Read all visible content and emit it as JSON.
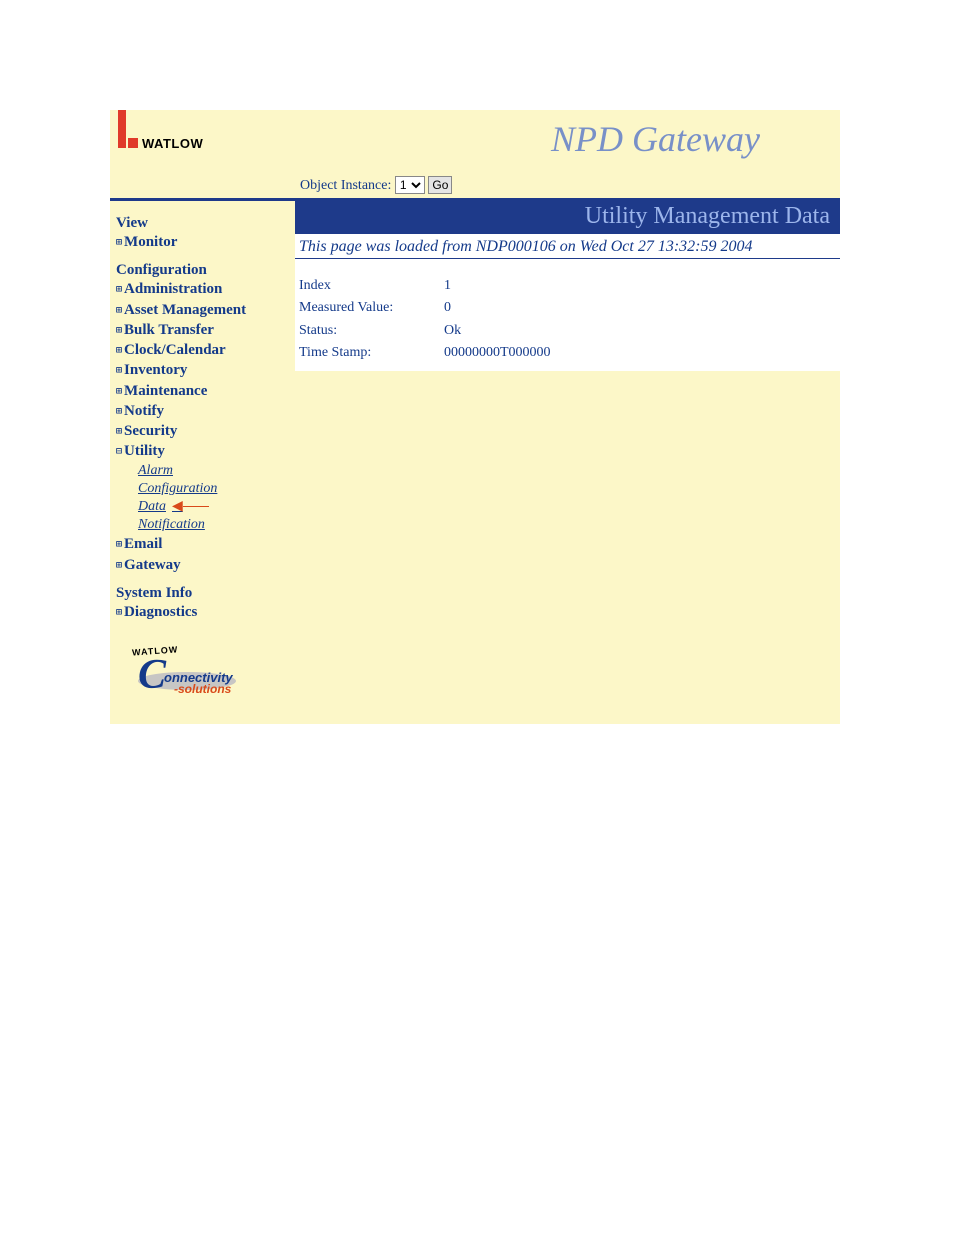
{
  "logo_text": "WATLOW",
  "app_title": "NPD Gateway",
  "object_instance_label": "Object Instance:",
  "object_instance_value": "1",
  "go_label": "Go",
  "sidebar": {
    "view": {
      "heading": "View",
      "monitor": "Monitor"
    },
    "configuration": {
      "heading": "Configuration",
      "administration": "Administration",
      "asset_management": "Asset Management",
      "bulk_transfer": "Bulk Transfer",
      "clock_calendar": "Clock/Calendar",
      "inventory": "Inventory",
      "maintenance": "Maintenance",
      "notify": "Notify",
      "security": "Security",
      "utility": "Utility",
      "utility_children": {
        "alarm": "Alarm",
        "configuration": "Configuration",
        "data": "Data",
        "notification": "Notification"
      },
      "email": "Email",
      "gateway": "Gateway"
    },
    "system_info": {
      "heading": "System Info",
      "diagnostics": "Diagnostics"
    }
  },
  "footer_logo": {
    "arc": "WATLOW",
    "word1": "onnectivity",
    "word2": "-solutions"
  },
  "main": {
    "banner": "Utility Management Data",
    "loaded_msg": "This page was loaded from NDP000106 on Wed Oct 27 13:32:59 2004",
    "rows": {
      "index_label": "Index",
      "index_value": "1",
      "measured_label": "Measured Value:",
      "measured_value": "0",
      "status_label": "Status:",
      "status_value": "Ok",
      "timestamp_label": "Time Stamp:",
      "timestamp_value": "00000000T000000"
    }
  },
  "tree_glyph_plus": "⊞",
  "tree_glyph_minus": "⊟"
}
